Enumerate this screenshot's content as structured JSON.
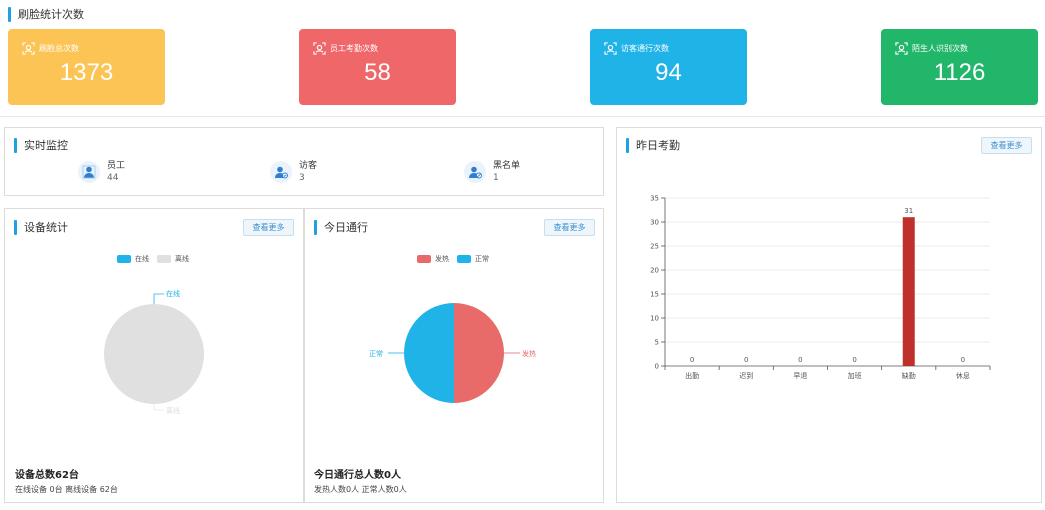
{
  "header": {
    "title": "刷脸统计次数"
  },
  "stats": [
    {
      "label": "刷脸总次数",
      "value": "1373",
      "color": "#fcc455",
      "icon": "face-scan-icon"
    },
    {
      "label": "员工考勤次数",
      "value": "58",
      "color": "#f0676a",
      "icon": "face-scan-icon"
    },
    {
      "label": "访客通行次数",
      "value": "94",
      "color": "#1fb3e8",
      "icon": "face-scan-icon"
    },
    {
      "label": "陌生人识别次数",
      "value": "1126",
      "color": "#22b66b",
      "icon": "face-scan-icon"
    }
  ],
  "monitor": {
    "title": "实时监控",
    "items": [
      {
        "label": "员工",
        "value": "44",
        "icon": "employee-icon"
      },
      {
        "label": "访客",
        "value": "3",
        "icon": "visitor-icon"
      },
      {
        "label": "黑名单",
        "value": "1",
        "icon": "blacklist-icon"
      }
    ]
  },
  "device": {
    "title": "设备统计",
    "more": "查看更多",
    "legend": [
      "在线",
      "离线"
    ],
    "pie_labels": {
      "online": "在线",
      "offline": "离线"
    },
    "total": "设备总数62台",
    "detail": "在线设备 0台   离线设备 62台",
    "colors": {
      "online": "#1fb3e8",
      "offline": "#e0e0e0"
    }
  },
  "pass": {
    "title": "今日通行",
    "more": "查看更多",
    "legend": [
      "发热",
      "正常"
    ],
    "pie_labels": {
      "fever": "发热",
      "normal": "正常"
    },
    "total": "今日通行总人数0人",
    "detail": "发热人数0人   正常人数0人",
    "colors": {
      "fever": "#e86a69",
      "normal": "#1fb3e8"
    }
  },
  "attendance": {
    "title": "昨日考勤",
    "more": "查看更多"
  },
  "chart_data": {
    "type": "bar",
    "categories": [
      "出勤",
      "迟到",
      "早退",
      "加班",
      "缺勤",
      "休息"
    ],
    "values": [
      0,
      0,
      0,
      0,
      31,
      0
    ],
    "ylim": [
      0,
      35
    ],
    "yticks": [
      0,
      5,
      10,
      15,
      20,
      25,
      30,
      35
    ],
    "bar_color": "#c0302a",
    "grid": true
  }
}
